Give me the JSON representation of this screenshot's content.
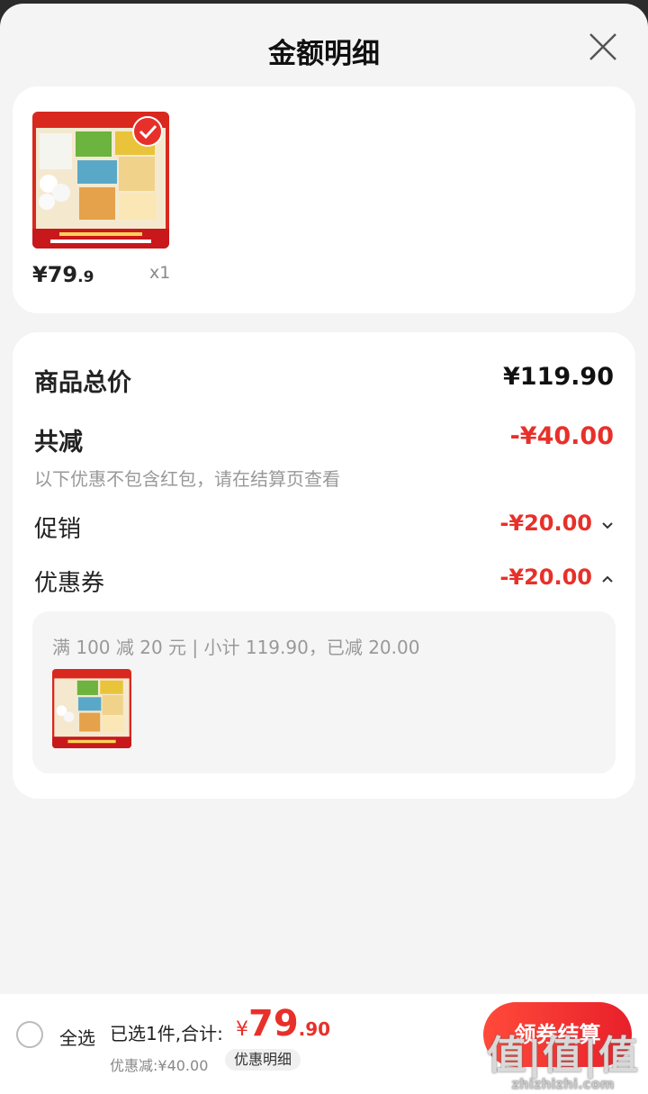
{
  "sheet": {
    "title": "金额明细"
  },
  "product": {
    "price_int": "¥79",
    "price_dec": ".9",
    "qty": "x1"
  },
  "breakdown": {
    "total_label": "商品总价",
    "total_value": "¥119.90",
    "reduce_label": "共减",
    "reduce_value": "-¥40.00",
    "hint": "以下优惠不包含红包，请在结算页查看",
    "promo_label": "促销",
    "promo_value": "-¥20.00",
    "coupon_label": "优惠券",
    "coupon_value": "-¥20.00",
    "coupon_detail": "满 100 减 20 元 | 小计 119.90，已减 20.00"
  },
  "footer": {
    "select_all": "全选",
    "summary": "已选1件,合计:",
    "sym": "¥",
    "price_int": "79",
    "price_dec": ".90",
    "discount": "优惠减:¥40.00",
    "detail_btn": "优惠明细",
    "checkout": "领券结算"
  },
  "watermark": {
    "logo": "值|值|值",
    "domain": "zhizhizhi.com"
  },
  "colors": {
    "accent": "#e8302a",
    "bg": "#f4f4f4"
  }
}
